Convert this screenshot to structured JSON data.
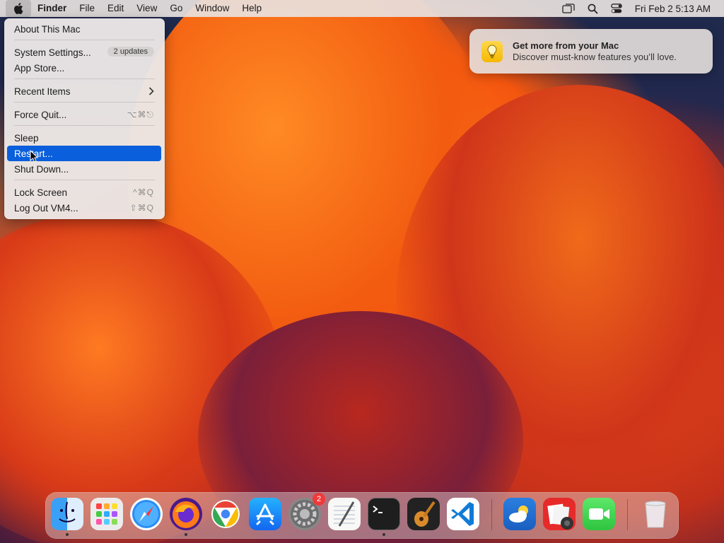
{
  "menubar": {
    "app_name": "Finder",
    "menus": [
      "File",
      "Edit",
      "View",
      "Go",
      "Window",
      "Help"
    ],
    "clock": "Fri Feb 2  5:13 AM",
    "status_icons": [
      "screen-mirroring-icon",
      "search-icon",
      "control-center-icon"
    ]
  },
  "apple_menu": {
    "about": "About This Mac",
    "system_settings": "System Settings...",
    "updates_badge": "2 updates",
    "app_store": "App Store...",
    "recent_items": "Recent Items",
    "force_quit": "Force Quit...",
    "force_quit_shortcut": "⌥⌘⎋",
    "sleep": "Sleep",
    "restart": "Restart...",
    "shut_down": "Shut Down...",
    "lock_screen": "Lock Screen",
    "lock_shortcut": "^⌘Q",
    "log_out": "Log Out VM4...",
    "log_out_shortcut": "⇧⌘Q",
    "selected": "Restart..."
  },
  "notification": {
    "title": "Get more from your Mac",
    "body": "Discover must-know features you’ll love.",
    "icon": "lightbulb-icon"
  },
  "dock": {
    "apps": [
      "Finder",
      "Launchpad",
      "Safari",
      "Firefox",
      "Chrome",
      "App Store",
      "System Settings",
      "TextEdit",
      "Terminal",
      "GarageBand",
      "VS Code",
      "Weather",
      "Photo Booth",
      "FaceTime",
      "Trash"
    ],
    "system_settings_badge": "2",
    "colors": {
      "accent": "#0a5fdc",
      "badge": "#f0393a"
    }
  }
}
